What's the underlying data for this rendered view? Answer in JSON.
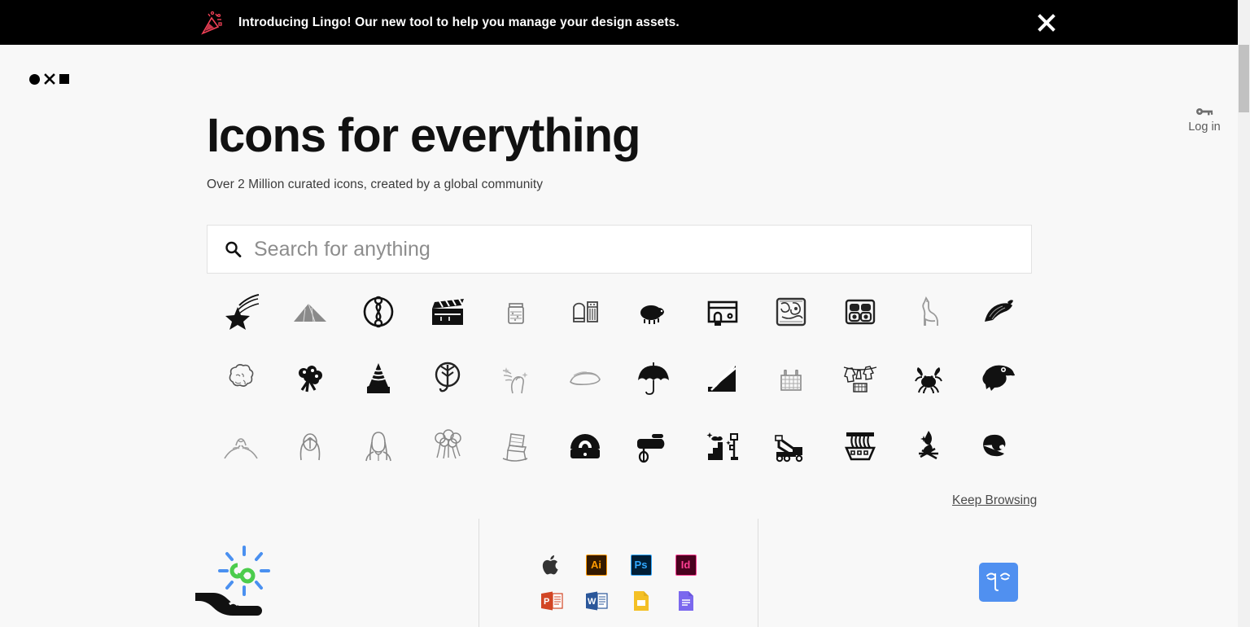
{
  "banner": {
    "icon": "party-popper-icon",
    "text": "Introducing Lingo! Our new tool to help you manage your design assets.",
    "close_icon": "close-icon",
    "background_color": "#000000",
    "text_color": "#ffffff",
    "icon_color": "#ef4056"
  },
  "header": {
    "logo": {
      "name": "noun-project-logo",
      "shapes": [
        "circle",
        "x",
        "square"
      ]
    },
    "login": {
      "icon": "key-icon",
      "label": "Log in"
    }
  },
  "hero": {
    "title": "Icons for everything",
    "subtitle": "Over 2 Million curated icons, created by a global community"
  },
  "search": {
    "icon": "search-icon",
    "value": "",
    "placeholder": "Search for anything"
  },
  "icon_grid": {
    "rows": 3,
    "columns": 12,
    "items": [
      {
        "name": "shooting-star-icon"
      },
      {
        "name": "mountain-icon"
      },
      {
        "name": "circle-knot-icon"
      },
      {
        "name": "clapperboard-icon"
      },
      {
        "name": "jar-icon"
      },
      {
        "name": "salt-pepper-shaker-icon"
      },
      {
        "name": "sheep-icon"
      },
      {
        "name": "storefront-icon"
      },
      {
        "name": "mayan-glyph-icon"
      },
      {
        "name": "mayan-mask-icon"
      },
      {
        "name": "llama-icon"
      },
      {
        "name": "bird-icon"
      },
      {
        "name": "brain-cloud-icon"
      },
      {
        "name": "broccoli-icon"
      },
      {
        "name": "cone-hill-icon"
      },
      {
        "name": "tree-circle-icon"
      },
      {
        "name": "hand-sparkle-icon"
      },
      {
        "name": "sandwich-icon"
      },
      {
        "name": "umbrella-icon"
      },
      {
        "name": "stairs-icon"
      },
      {
        "name": "basket-icon"
      },
      {
        "name": "laundry-line-icon"
      },
      {
        "name": "crab-icon"
      },
      {
        "name": "eagle-head-icon"
      },
      {
        "name": "pinky-promise-icon"
      },
      {
        "name": "hooded-figure-icon"
      },
      {
        "name": "woman-portrait-icon"
      },
      {
        "name": "mushrooms-icon"
      },
      {
        "name": "rocking-chair-icon"
      },
      {
        "name": "egg-cooker-icon"
      },
      {
        "name": "hand-mixer-icon"
      },
      {
        "name": "construction-site-icon"
      },
      {
        "name": "crane-truck-icon"
      },
      {
        "name": "noodle-bowl-icon"
      },
      {
        "name": "campfire-icon"
      },
      {
        "name": "snail-leaf-icon"
      }
    ]
  },
  "keep_browsing": {
    "label": "Keep Browsing"
  },
  "panels": [
    {
      "name": "unlimited-downloads-panel",
      "icon": "hand-infinity-icon",
      "colors": {
        "infinity": "#4ccc4c",
        "rays": "#4a90f0",
        "hand": "#111111"
      }
    },
    {
      "name": "app-integrations-panel",
      "apps": [
        {
          "name": "apple-icon",
          "label": "",
          "bg": "",
          "fg": "#333333"
        },
        {
          "name": "illustrator-icon",
          "label": "Ai",
          "bg": "#341a00",
          "fg": "#ff9a00",
          "border": "#ff9a00"
        },
        {
          "name": "photoshop-icon",
          "label": "Ps",
          "bg": "#001e36",
          "fg": "#31a8ff",
          "border": "#31a8ff"
        },
        {
          "name": "indesign-icon",
          "label": "Id",
          "bg": "#49021f",
          "fg": "#ff3f93",
          "border": "#ff3f93"
        },
        {
          "name": "powerpoint-icon",
          "label": "P",
          "bg": "#d24625",
          "fg": "#ffffff"
        },
        {
          "name": "word-icon",
          "label": "W",
          "bg": "#2b579a",
          "fg": "#ffffff"
        },
        {
          "name": "google-slides-icon",
          "label": "",
          "bg": "#f4c025",
          "fg": "#ffffff"
        },
        {
          "name": "google-docs-icon",
          "label": "",
          "bg": "#7b68ee",
          "fg": "#ffffff"
        }
      ]
    },
    {
      "name": "face-panel",
      "icon": "face-icon",
      "background_color": "#5090f0"
    }
  ],
  "scrollbar": {
    "name": "vertical-scrollbar"
  },
  "theme": {
    "page_background": "#f8f8f8",
    "text_primary": "#111111",
    "text_muted": "#5b5b5b",
    "divider": "#dcdcdc"
  }
}
